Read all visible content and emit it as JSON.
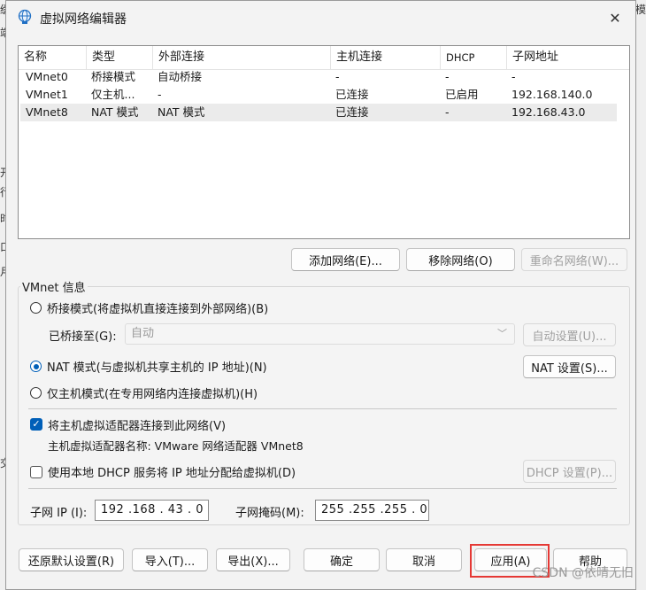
{
  "window": {
    "title": "虚拟网络编辑器",
    "close": "✕"
  },
  "table": {
    "headers": [
      "名称",
      "类型",
      "外部连接",
      "主机连接",
      "DHCP",
      "子网地址"
    ],
    "rows": [
      [
        "VMnet0",
        "桥接模式",
        "自动桥接",
        "-",
        "-",
        "-"
      ],
      [
        "VMnet1",
        "仅主机...",
        "-",
        "已连接",
        "已启用",
        "192.168.140.0"
      ],
      [
        "VMnet8",
        "NAT 模式",
        "NAT 模式",
        "已连接",
        "-",
        "192.168.43.0"
      ]
    ],
    "selected_row": 2
  },
  "list_buttons": {
    "add": "添加网络(E)...",
    "remove": "移除网络(O)",
    "rename": "重命名网络(W)..."
  },
  "info": {
    "group_label": "VMnet 信息",
    "bridge_label": "桥接模式(将虚拟机直接连接到外部网络)(B)",
    "bridged_to_label": "已桥接至(G):",
    "bridged_to_value": "自动",
    "auto_settings": "自动设置(U)...",
    "nat_label": "NAT 模式(与虚拟机共享主机的 IP 地址)(N)",
    "nat_settings": "NAT 设置(S)...",
    "hostonly_label": "仅主机模式(在专用网络内连接虚拟机)(H)",
    "connect_adapter_label": "将主机虚拟适配器连接到此网络(V)",
    "adapter_name": "主机虚拟适配器名称: VMware 网络适配器 VMnet8",
    "dhcp_label": "使用本地 DHCP 服务将 IP 地址分配给虚拟机(D)",
    "dhcp_settings": "DHCP 设置(P)...",
    "subnet_ip_label": "子网 IP (I):",
    "subnet_ip_value": "192 .168 . 43  .  0",
    "subnet_mask_label": "子网掩码(M):",
    "subnet_mask_value": "255 .255 .255 .  0",
    "selected_mode": "nat",
    "connect_adapter_checked": true,
    "dhcp_checked": false
  },
  "footer": {
    "restore": "还原默认设置(R)",
    "import": "导入(T)...",
    "export": "导出(X)...",
    "ok": "确定",
    "cancel": "取消",
    "apply": "应用(A)",
    "help": "帮助"
  },
  "background": {
    "left_chars": [
      "缓",
      "端",
      "开",
      "行",
      "时",
      "口",
      "月",
      "交"
    ],
    "right_chars": [
      "模"
    ]
  },
  "watermark": "CSDN @依晴无旧",
  "colors": {
    "accent": "#005fb8",
    "highlight": "#e53935"
  }
}
